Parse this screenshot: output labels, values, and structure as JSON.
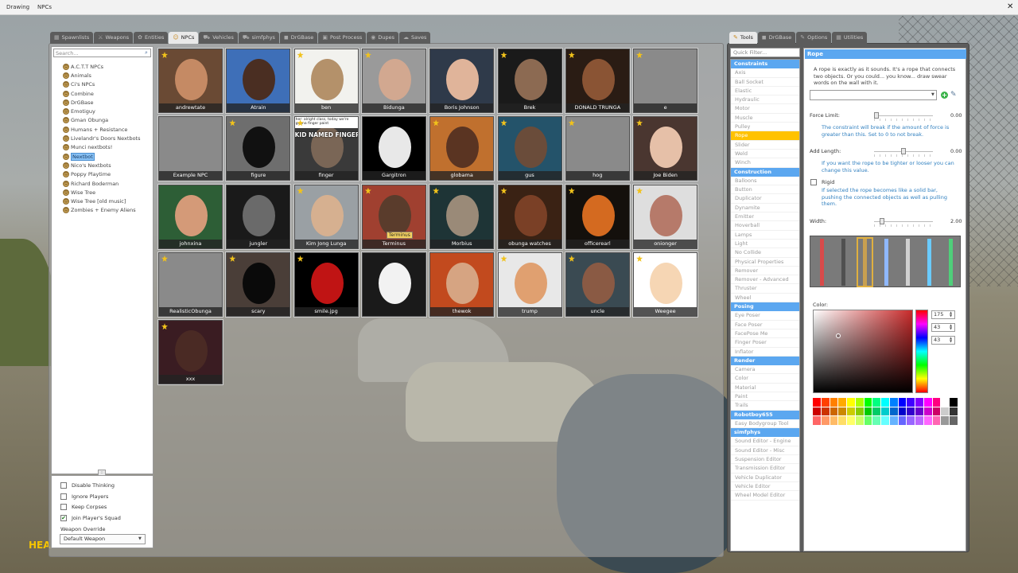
{
  "menubar": {
    "items": [
      "Drawing",
      "NPCs"
    ],
    "close": "✕"
  },
  "spawn_tabs": [
    {
      "label": "Spawnlists",
      "icon": "▦",
      "active": false
    },
    {
      "label": "Weapons",
      "icon": "⚔",
      "active": false
    },
    {
      "label": "Entities",
      "icon": "✿",
      "active": false
    },
    {
      "label": "NPCs",
      "icon": "☺",
      "active": true
    },
    {
      "label": "Vehicles",
      "icon": "⛟",
      "active": false
    },
    {
      "label": "simfphys",
      "icon": "⛟",
      "active": false
    },
    {
      "label": "DrGBase",
      "icon": "◼",
      "active": false
    },
    {
      "label": "Post Process",
      "icon": "▣",
      "active": false
    },
    {
      "label": "Dupes",
      "icon": "◉",
      "active": false
    },
    {
      "label": "Saves",
      "icon": "☁",
      "active": false
    }
  ],
  "tool_tabs": [
    {
      "label": "Tools",
      "icon": "✎",
      "active": true
    },
    {
      "label": "DrGBase",
      "icon": "◼",
      "active": false
    },
    {
      "label": "Options",
      "icon": "✎",
      "active": false
    },
    {
      "label": "Utilities",
      "icon": "▦",
      "active": false
    }
  ],
  "search": {
    "placeholder": "Search..."
  },
  "categories": [
    {
      "label": "A.C.T.T NPCs",
      "selected": false
    },
    {
      "label": "Animals",
      "selected": false
    },
    {
      "label": "Ci's NPCs",
      "selected": false
    },
    {
      "label": "Combine",
      "selected": false
    },
    {
      "label": "DrGBase",
      "selected": false
    },
    {
      "label": "Emotiguy",
      "selected": false
    },
    {
      "label": "Gman Obunga",
      "selected": false
    },
    {
      "label": "Humans + Resistance",
      "selected": false
    },
    {
      "label": "Livelandr's Doors Nextbots",
      "selected": false
    },
    {
      "label": "Munci nextbots!",
      "selected": false
    },
    {
      "label": "Nextbot",
      "selected": true
    },
    {
      "label": "Nico's Nextbots",
      "selected": false
    },
    {
      "label": "Poppy Playtime",
      "selected": false
    },
    {
      "label": "Richard Boderman",
      "selected": false
    },
    {
      "label": "Wise Tree",
      "selected": false
    },
    {
      "label": "Wise Tree [old music]",
      "selected": false
    },
    {
      "label": "Zombies + Enemy Aliens",
      "selected": false
    }
  ],
  "options": {
    "checkboxes": [
      {
        "label": "Disable Thinking",
        "checked": false
      },
      {
        "label": "Ignore Players",
        "checked": false
      },
      {
        "label": "Keep Corpses",
        "checked": false
      },
      {
        "label": "Join Player's Squad",
        "checked": true
      }
    ],
    "weapon_label": "Weapon Override",
    "weapon_value": "Default Weapon"
  },
  "npcs": [
    {
      "label": "andrewtate",
      "fav": true,
      "bg": "#6a4a34",
      "face": "#c58a64"
    },
    {
      "label": "Atrain",
      "fav": false,
      "bg": "#3e6fb8",
      "face": "#4a2e22"
    },
    {
      "label": "ben",
      "fav": true,
      "bg": "#f2f2ee",
      "face": "#b4916a"
    },
    {
      "label": "Bidunga",
      "fav": true,
      "bg": "#9a9a9a",
      "face": "#d2a890"
    },
    {
      "label": "Boris Johnson",
      "fav": false,
      "bg": "#2f3a4a",
      "face": "#e0b49a"
    },
    {
      "label": "Brek",
      "fav": true,
      "bg": "#1a1a1a",
      "face": "#8c6a52"
    },
    {
      "label": "DONALD TRUNGA",
      "fav": true,
      "bg": "#2a1c14",
      "face": "#8a5434"
    },
    {
      "label": "e",
      "fav": true,
      "bg": "#8a8a8a",
      "face": ""
    },
    {
      "label": "Example NPC",
      "fav": false,
      "bg": "#8a8a8a",
      "face": ""
    },
    {
      "label": "figure",
      "fav": true,
      "bg": "#6e6e6e",
      "face": "#111111"
    },
    {
      "label": "finger",
      "fav": true,
      "bg": "#3a3a3a",
      "face": "#7a6656",
      "banner": "KID NAMED FINGER",
      "caption": "her: alright class, today we're gonna finger paint"
    },
    {
      "label": "Gargitron",
      "fav": false,
      "bg": "#000000",
      "face": "#e8e8e8"
    },
    {
      "label": "globama",
      "fav": true,
      "bg": "#c0702e",
      "face": "#5a3422"
    },
    {
      "label": "gus",
      "fav": true,
      "bg": "#24536a",
      "face": "#6a4c3a"
    },
    {
      "label": "hog",
      "fav": true,
      "bg": "#8a8a8a",
      "face": ""
    },
    {
      "label": "Joe Biden",
      "fav": true,
      "bg": "#4a3630",
      "face": "#e6c0a8"
    },
    {
      "label": "johnxina",
      "fav": false,
      "bg": "#2d5e36",
      "face": "#d49a78"
    },
    {
      "label": "jungler",
      "fav": false,
      "bg": "#1a1a1a",
      "face": "#6a6a6a"
    },
    {
      "label": "Kim Jong Lunga",
      "fav": true,
      "bg": "#9aa0a4",
      "face": "#d6b090"
    },
    {
      "label": "Terminus",
      "fav": true,
      "bg": "#a04030",
      "face": "#5a3c2c",
      "tag": "Terminus"
    },
    {
      "label": "Morbius",
      "fav": true,
      "bg": "#1e3436",
      "face": "#9a8a78"
    },
    {
      "label": "obunga watches",
      "fav": true,
      "bg": "#3a2214",
      "face": "#7a4026"
    },
    {
      "label": "officerearl",
      "fav": true,
      "bg": "#14100c",
      "face": "#d46a20"
    },
    {
      "label": "onionger",
      "fav": true,
      "bg": "#dedede",
      "face": "#b67a6a"
    },
    {
      "label": "RealisticObunga",
      "fav": true,
      "bg": "#8a8a8a",
      "face": ""
    },
    {
      "label": "scary",
      "fav": true,
      "bg": "#4a3e38",
      "face": "#0a0a0a"
    },
    {
      "label": "smile.jpg",
      "fav": true,
      "bg": "#000000",
      "face": "#c01414"
    },
    {
      "label": "",
      "fav": false,
      "bg": "#1a1a1a",
      "face": "#f2f2f2"
    },
    {
      "label": "thewok",
      "fav": false,
      "bg": "#c24a1e",
      "face": "#d6a482"
    },
    {
      "label": "trump",
      "fav": true,
      "bg": "#e8e8e8",
      "face": "#e0a070"
    },
    {
      "label": "uncle",
      "fav": true,
      "bg": "#3a4a52",
      "face": "#8a5a44"
    },
    {
      "label": "Weegee",
      "fav": true,
      "bg": "#ffffff",
      "face": "#f6d6b4"
    },
    {
      "label": "xxx",
      "fav": true,
      "bg": "#3a1c22",
      "face": "#4a2a24"
    }
  ],
  "tools": {
    "filter_placeholder": "Quick Filter...",
    "groups": [
      {
        "title": "Constraints",
        "items": [
          "Axis",
          "Ball Socket",
          "Elastic",
          "Hydraulic",
          "Motor",
          "Muscle",
          "Pulley",
          "Rope",
          "Slider",
          "Weld",
          "Winch"
        ]
      },
      {
        "title": "Construction",
        "items": [
          "Balloons",
          "Button",
          "Duplicator",
          "Dynamite",
          "Emitter",
          "Hoverball",
          "Lamps",
          "Light",
          "No Collide",
          "Physical Properties",
          "Remover",
          "Remover - Advanced",
          "Thruster",
          "Wheel"
        ]
      },
      {
        "title": "Posing",
        "items": [
          "Eye Poser",
          "Face Poser",
          "FacePose Me",
          "Finger Poser",
          "Inflator"
        ]
      },
      {
        "title": "Render",
        "items": [
          "Camera",
          "Color",
          "Material",
          "Paint",
          "Trails"
        ]
      },
      {
        "title": "Robotboy655",
        "items": [
          "Easy Bodygroup Tool"
        ]
      },
      {
        "title": "simfphys",
        "items": [
          "Sound Editor - Engine",
          "Sound Editor - Misc",
          "Suspension Editor",
          "Transmission Editor",
          "Vehicle Duplicator",
          "Vehicle Editor",
          "Wheel Model Editor"
        ]
      }
    ],
    "selected": "Rope"
  },
  "rope": {
    "title": "Rope",
    "description": "A rope is exactly as it sounds. It's a rope that connects two objects. Or you could... you know... draw swear words on the wall with it.",
    "force_limit_label": "Force Limit:",
    "force_limit_value": "0.00",
    "force_limit_help": "The constraint will break if the amount of force is greater than this. Set to 0 to not break.",
    "add_length_label": "Add Length:",
    "add_length_value": "0.00",
    "add_length_help": "If you want the rope to be tighter or looser you can change this value.",
    "rigid_label": "Rigid",
    "rigid_checked": false,
    "rigid_help": "If selected the rope becomes like a solid bar, pushing the connected objects as well as pulling them.",
    "width_label": "Width:",
    "width_value": "2.00",
    "width_fraction": 0.1,
    "force_fraction": 0.0,
    "length_fraction": 0.5,
    "color_label": "Color:",
    "r": "175",
    "g": "43",
    "b": "43",
    "materials": [
      "#d84a4a",
      "#505050",
      "#c8a050",
      "#8fb8ff",
      "#d0d0d0",
      "#6acbff",
      "#4fcf7a"
    ],
    "palette": [
      "#ff0000",
      "#ff4000",
      "#ff8000",
      "#ffaa00",
      "#ffff00",
      "#aaff00",
      "#00ff00",
      "#00ff80",
      "#00ffff",
      "#0080ff",
      "#0000ff",
      "#4000ff",
      "#8000ff",
      "#ff00ff",
      "#ff0080",
      "#ffffff",
      "#000000",
      "#cc0000",
      "#cc3300",
      "#cc6600",
      "#cc8800",
      "#cccc00",
      "#88cc00",
      "#00cc00",
      "#00cc66",
      "#00cccc",
      "#0066cc",
      "#0000cc",
      "#3300cc",
      "#6600cc",
      "#cc00cc",
      "#cc0066",
      "#cccccc",
      "#333333",
      "#ff6666",
      "#ff9966",
      "#ffbb66",
      "#ffdd66",
      "#ffff66",
      "#ccff66",
      "#66ff66",
      "#66ffb3",
      "#66ffff",
      "#66b3ff",
      "#6666ff",
      "#9966ff",
      "#bb66ff",
      "#ff66ff",
      "#ff66b3",
      "#999999",
      "#666666"
    ]
  }
}
